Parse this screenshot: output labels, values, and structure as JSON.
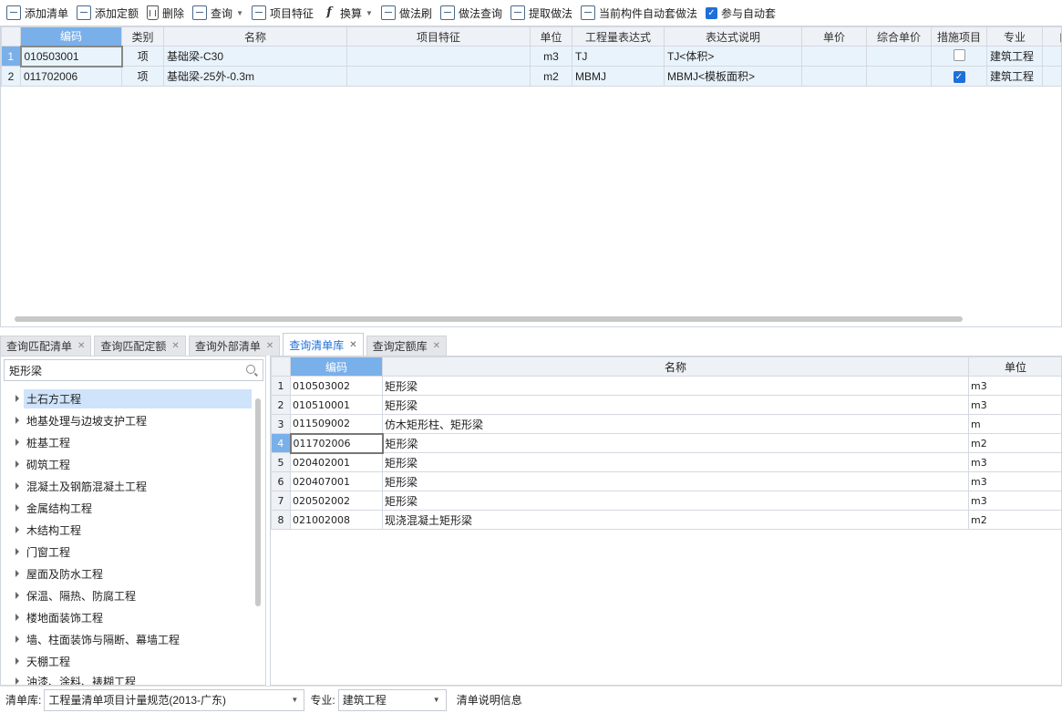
{
  "toolbar": {
    "add_list": "添加清单",
    "add_quota": "添加定额",
    "delete": "删除",
    "query": "查询",
    "item_feature": "项目特征",
    "convert": "换算",
    "method_brush": "做法刷",
    "method_query": "做法查询",
    "extract_method": "提取做法",
    "auto_apply_current": "当前构件自动套做法",
    "participate_auto": "参与自动套",
    "participate_auto_checked": true
  },
  "top_grid": {
    "columns": [
      "编码",
      "类别",
      "名称",
      "项目特征",
      "单位",
      "工程量表达式",
      "表达式说明",
      "单价",
      "综合单价",
      "措施项目",
      "专业",
      "自"
    ],
    "rows": [
      {
        "num": "1",
        "code": "010503001",
        "type": "项",
        "name": "基础梁-C30",
        "feature": "",
        "unit": "m3",
        "expr": "TJ",
        "expr_desc": "TJ<体积>",
        "price": "",
        "comp_price": "",
        "measure": false,
        "discipline": "建筑工程"
      },
      {
        "num": "2",
        "code": "011702006",
        "type": "项",
        "name": "基础梁-25外-0.3m",
        "feature": "",
        "unit": "m2",
        "expr": "MBMJ",
        "expr_desc": "MBMJ<模板面积>",
        "price": "",
        "comp_price": "",
        "measure": true,
        "discipline": "建筑工程"
      }
    ]
  },
  "tabs": [
    {
      "label": "查询匹配清单"
    },
    {
      "label": "查询匹配定额"
    },
    {
      "label": "查询外部清单"
    },
    {
      "label": "查询清单库"
    },
    {
      "label": "查询定额库"
    }
  ],
  "left_panel": {
    "search_value": "矩形梁",
    "tree": [
      "土石方工程",
      "地基处理与边坡支护工程",
      "桩基工程",
      "砌筑工程",
      "混凝土及钢筋混凝土工程",
      "金属结构工程",
      "木结构工程",
      "门窗工程",
      "屋面及防水工程",
      "保温、隔热、防腐工程",
      "楼地面装饰工程",
      "墙、柱面装饰与隔断、幕墙工程",
      "天棚工程",
      "油漆、涂料、裱糊工程"
    ]
  },
  "right_grid": {
    "columns": [
      "编码",
      "名称",
      "单位"
    ],
    "rows": [
      {
        "num": "1",
        "code": "010503002",
        "name": "矩形梁",
        "unit": "m3"
      },
      {
        "num": "2",
        "code": "010510001",
        "name": "矩形梁",
        "unit": "m3"
      },
      {
        "num": "3",
        "code": "011509002",
        "name": "仿木矩形柱、矩形梁",
        "unit": "m"
      },
      {
        "num": "4",
        "code": "011702006",
        "name": "矩形梁",
        "unit": "m2"
      },
      {
        "num": "5",
        "code": "020402001",
        "name": "矩形梁",
        "unit": "m3"
      },
      {
        "num": "6",
        "code": "020407001",
        "name": "矩形梁",
        "unit": "m3"
      },
      {
        "num": "7",
        "code": "020502002",
        "name": "矩形梁",
        "unit": "m3"
      },
      {
        "num": "8",
        "code": "021002008",
        "name": "现浇混凝土矩形梁",
        "unit": "m2"
      }
    ]
  },
  "bottom_bar": {
    "library_label": "清单库:",
    "library_value": "工程量清单项目计量规范(2013-广东)",
    "discipline_label": "专业:",
    "discipline_value": "建筑工程",
    "info_label": "清单说明信息"
  }
}
